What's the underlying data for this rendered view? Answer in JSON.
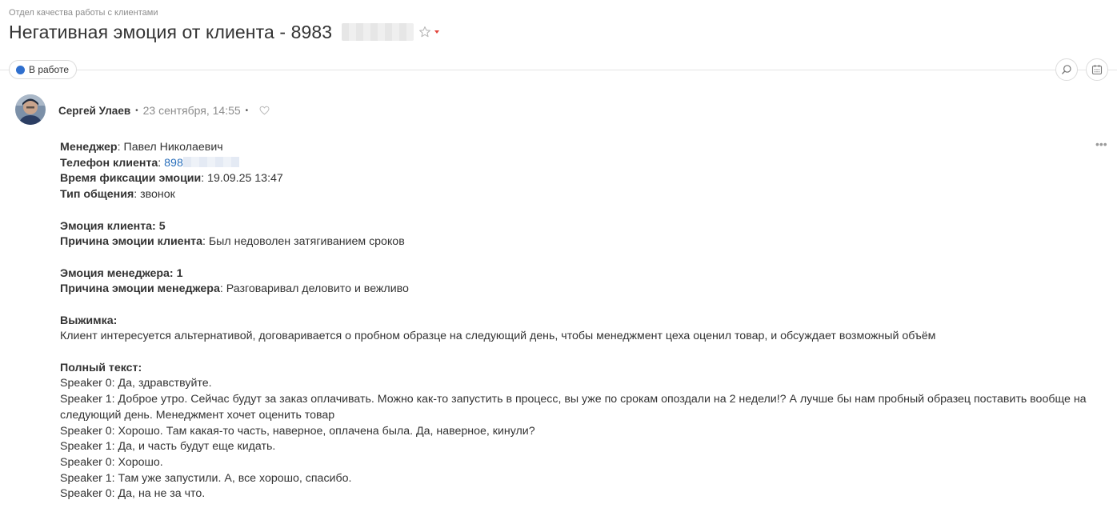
{
  "breadcrumb": "Отдел качества работы с клиентами",
  "title": "Негативная эмоция от клиента - 8983",
  "status": "В работе",
  "post": {
    "author": "Сергей Улаев",
    "date": "23 сентября, 14:55"
  },
  "fields": {
    "manager_label": "Менеджер",
    "manager_value": "Павел Николаевич",
    "phone_label": "Телефон клиента",
    "phone_value": "898",
    "time_label": "Время фиксации эмоции",
    "time_value": "19.09.25 13:47",
    "type_label": "Тип общения",
    "type_value": "звонок",
    "client_emotion": "Эмоция клиента: 5",
    "client_reason_label": "Причина эмоции клиента",
    "client_reason_value": "Был недоволен затягиванием сроков",
    "manager_emotion": "Эмоция менеджера: 1",
    "manager_reason_label": "Причина эмоции менеджера",
    "manager_reason_value": "Разговаривал деловито и вежливо",
    "summary_label": "Выжимка:",
    "summary_text": "Клиент интересуется альтернативой, договаривается о пробном образце на следующий день, чтобы менеджмент цеха оценил товар, и обсуждает возможный объём",
    "fulltext_label": "Полный текст:"
  },
  "transcript": [
    "Speaker 0: Да, здравствуйте.",
    "Speaker 1: Доброе утро. Сейчас будут за заказ оплачивать. Можно как-то запустить в процесс, вы уже по срокам опоздали на 2 недели!? А лучше бы нам пробный образец поставить вообще на следующий день. Менеджмент хочет оценить товар",
    "Speaker 0: Хорошо. Там какая-то часть, наверное, оплачена была. Да, наверное, кинули?",
    "Speaker 1: Да, и часть будут еще кидать.",
    "Speaker 0: Хорошо.",
    "Speaker 1: Там уже запустили. А, все хорошо, спасибо.",
    "Speaker 0: Да, на не за что."
  ],
  "colors": {
    "status_dot": "#2f6fce",
    "link": "#2a6fbb",
    "caret": "#e2443c"
  },
  "icons": [
    "star-icon",
    "chevron-down-icon",
    "search-icon",
    "calendar-icon",
    "heart-icon",
    "more-icon",
    "avatar"
  ]
}
